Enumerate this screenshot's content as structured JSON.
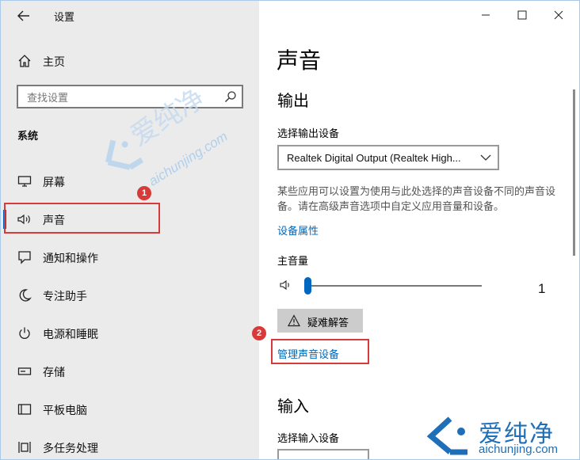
{
  "window": {
    "title": "设置"
  },
  "sidebar": {
    "home_label": "主页",
    "search_placeholder": "查找设置",
    "section_title": "系统",
    "items": [
      {
        "label": "屏幕",
        "icon": "display-icon"
      },
      {
        "label": "声音",
        "icon": "speaker-icon",
        "selected": true
      },
      {
        "label": "通知和操作",
        "icon": "notification-icon"
      },
      {
        "label": "专注助手",
        "icon": "moon-icon"
      },
      {
        "label": "电源和睡眠",
        "icon": "power-icon"
      },
      {
        "label": "存储",
        "icon": "storage-icon"
      },
      {
        "label": "平板电脑",
        "icon": "tablet-icon"
      },
      {
        "label": "多任务处理",
        "icon": "multitask-icon"
      }
    ]
  },
  "main": {
    "title": "声音",
    "output": {
      "heading": "输出",
      "device_label": "选择输出设备",
      "device_value": "Realtek Digital Output (Realtek High...",
      "description": "某些应用可以设置为使用与此处选择的声音设备不同的声音设备。请在高级声音选项中自定义应用音量和设备。",
      "properties_link": "设备属性",
      "volume_label": "主音量",
      "volume_value": "1",
      "volume_level": 0.01,
      "troubleshoot_label": "疑难解答",
      "manage_link": "管理声音设备"
    },
    "input": {
      "heading": "输入",
      "device_label": "选择输入设备"
    }
  },
  "annotations": {
    "badge1": "1",
    "badge2": "2"
  },
  "watermark": {
    "brand": "爱纯净",
    "url": "aichunjing.com"
  },
  "colors": {
    "accent": "#0067c0",
    "link": "#0067b8",
    "highlight": "#d83a3a",
    "sidebar_bg": "#ebebeb"
  }
}
